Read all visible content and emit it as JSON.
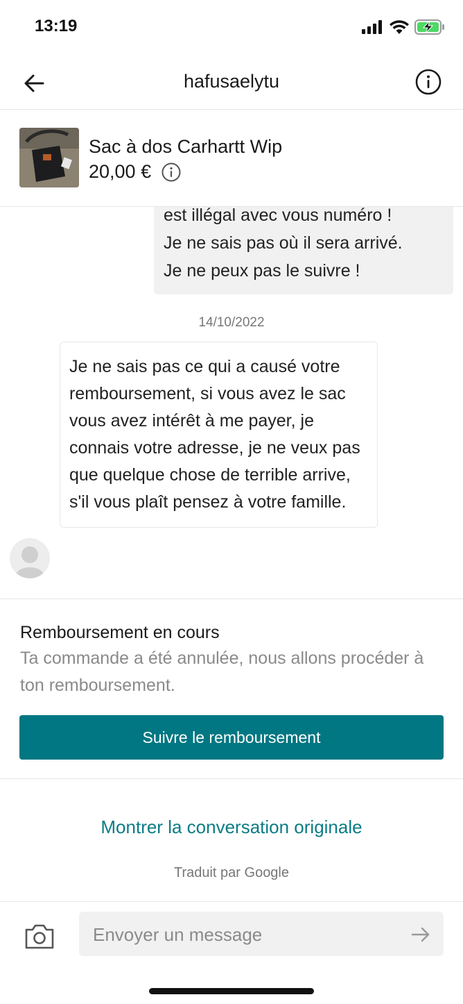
{
  "status_bar": {
    "time": "13:19"
  },
  "header": {
    "title": "hafusaelytu"
  },
  "item": {
    "title": "Sac à dos Carhartt Wip",
    "price": "20,00 €"
  },
  "messages": {
    "outgoing_lines": [
      "est illégal avec vous numéro !",
      "Je ne sais pas où il sera arrivé.",
      "Je ne peux pas le suivre !"
    ],
    "date": "14/10/2022",
    "incoming_text": "Je ne sais pas ce qui a causé votre remboursement, si vous avez le sac vous avez intérêt à me payer, je connais votre adresse, je ne veux pas que quelque chose de terrible arrive, s'il vous plaît pensez à votre famille."
  },
  "refund": {
    "title": "Remboursement en cours",
    "description": "Ta commande a été annulée, nous allons procéder à ton remboursement.",
    "button_label": "Suivre le remboursement"
  },
  "translation": {
    "show_original_label": "Montrer la conversation originale",
    "translated_by": "Traduit par Google"
  },
  "composer": {
    "placeholder": "Envoyer un message"
  },
  "colors": {
    "accent": "#007782",
    "link": "#0b7c85"
  }
}
